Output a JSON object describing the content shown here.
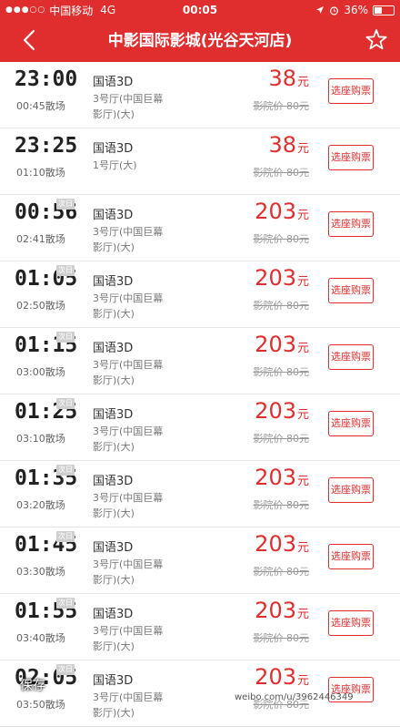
{
  "status_bar": {
    "signal": "●●●○○",
    "carrier": "中国移动",
    "network": "4G",
    "time": "00:05",
    "battery": "36%"
  },
  "nav": {
    "title": "中影国际影城(光谷天河店)",
    "back_icon": "chevron-left-icon",
    "star_icon": "star-outline-icon"
  },
  "colors": {
    "brand": "#e02e2e"
  },
  "showtimes": [
    {
      "start": "23:00",
      "tag": "",
      "end": "00:45散场",
      "lang": "国语3D",
      "hall": "3号厅(中国巨幕影厅)(大)",
      "price": "38",
      "unit": "元",
      "orig": "影院价 80元",
      "button": "选座购票"
    },
    {
      "start": "23:25",
      "tag": "",
      "end": "01:10散场",
      "lang": "国语3D",
      "hall": "1号厅(大)",
      "price": "38",
      "unit": "元",
      "orig": "影院价 80元",
      "button": "选座购票"
    },
    {
      "start": "00:56",
      "tag": "次日",
      "end": "02:41散场",
      "lang": "国语3D",
      "hall": "3号厅(中国巨幕影厅)(大)",
      "price": "203",
      "unit": "元",
      "orig": "影院价 80元",
      "button": "选座购票"
    },
    {
      "start": "01:05",
      "tag": "次日",
      "end": "02:50散场",
      "lang": "国语3D",
      "hall": "3号厅(中国巨幕影厅)(大)",
      "price": "203",
      "unit": "元",
      "orig": "影院价 80元",
      "button": "选座购票"
    },
    {
      "start": "01:15",
      "tag": "次日",
      "end": "03:00散场",
      "lang": "国语3D",
      "hall": "3号厅(中国巨幕影厅)(大)",
      "price": "203",
      "unit": "元",
      "orig": "影院价 80元",
      "button": "选座购票"
    },
    {
      "start": "01:25",
      "tag": "次日",
      "end": "03:10散场",
      "lang": "国语3D",
      "hall": "3号厅(中国巨幕影厅)(大)",
      "price": "203",
      "unit": "元",
      "orig": "影院价 80元",
      "button": "选座购票"
    },
    {
      "start": "01:35",
      "tag": "次日",
      "end": "03:20散场",
      "lang": "国语3D",
      "hall": "3号厅(中国巨幕影厅)(大)",
      "price": "203",
      "unit": "元",
      "orig": "影院价 80元",
      "button": "选座购票"
    },
    {
      "start": "01:45",
      "tag": "次日",
      "end": "03:30散场",
      "lang": "国语3D",
      "hall": "3号厅(中国巨幕影厅)(大)",
      "price": "203",
      "unit": "元",
      "orig": "影院价 80元",
      "button": "选座购票"
    },
    {
      "start": "01:55",
      "tag": "次日",
      "end": "03:40散场",
      "lang": "国语3D",
      "hall": "3号厅(中国巨幕影厅)(大)",
      "price": "203",
      "unit": "元",
      "orig": "影院价 80元",
      "button": "选座购票"
    },
    {
      "start": "02:05",
      "tag": "次日",
      "end": "03:50散场",
      "lang": "国语3D",
      "hall": "3号厅(中国巨幕影厅)(大)",
      "price": "203",
      "unit": "元",
      "orig": "影院价 80元",
      "button": "选座购票"
    }
  ],
  "overlay": {
    "save_label": "保存",
    "watermark": "weibo.com/u/3962446349"
  }
}
